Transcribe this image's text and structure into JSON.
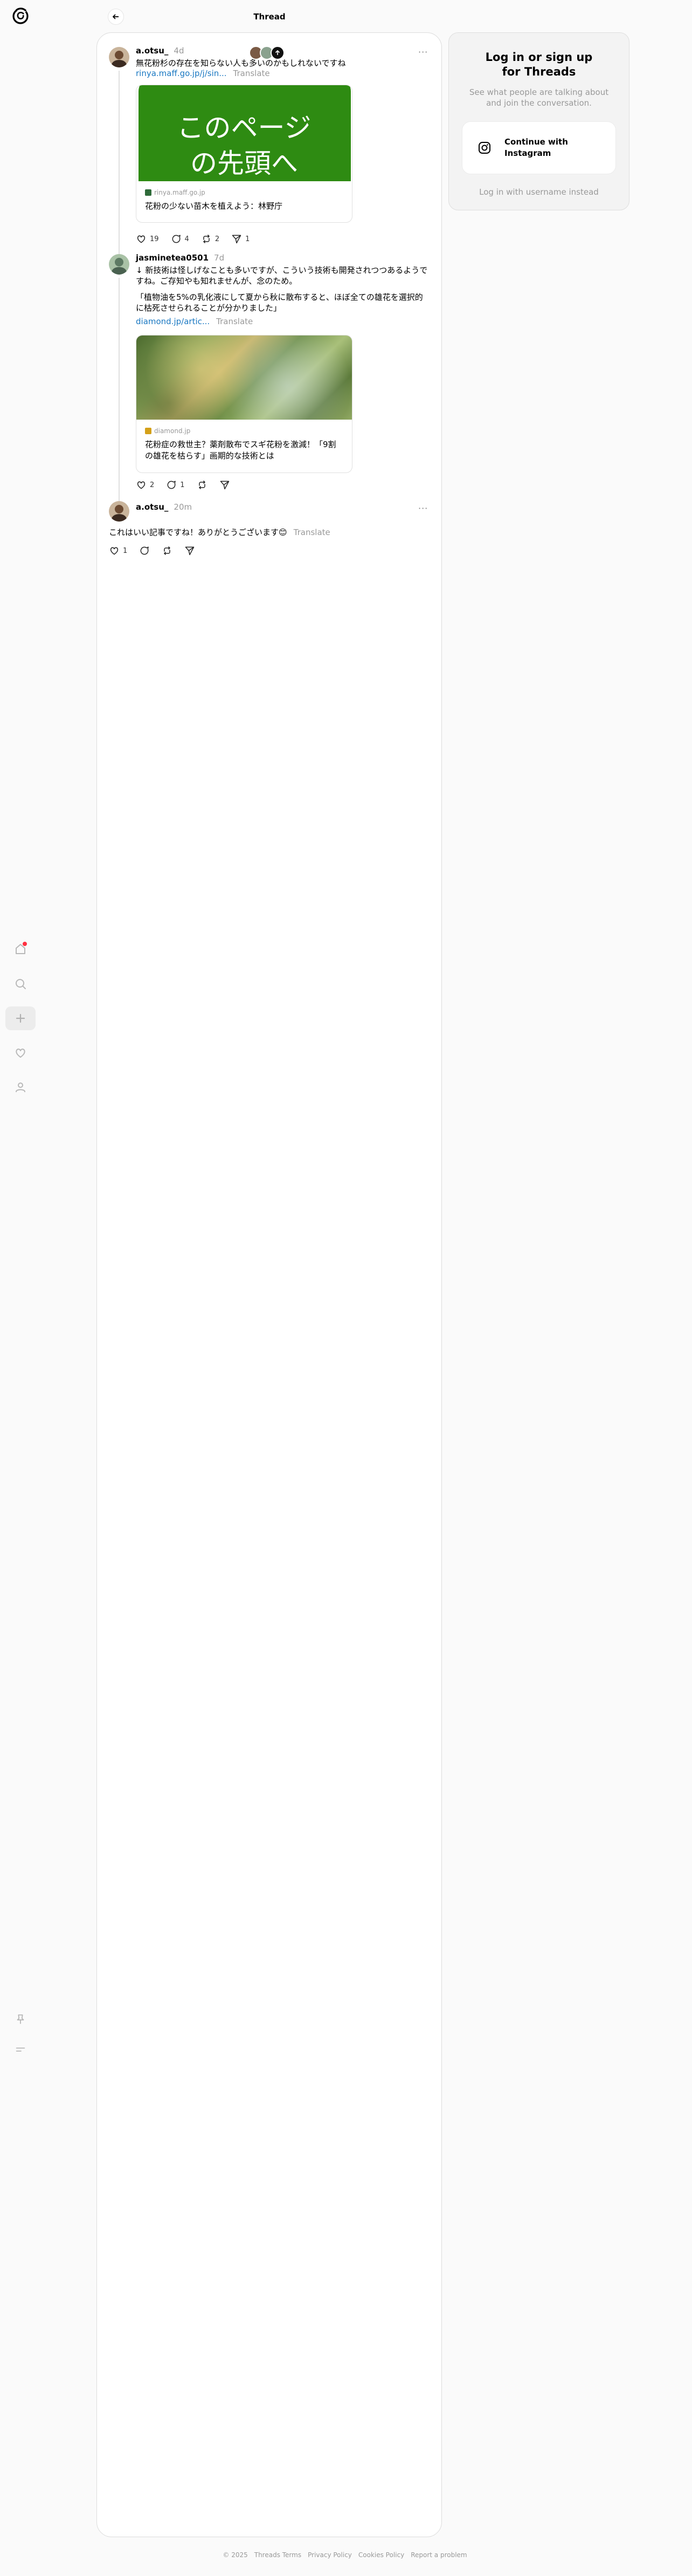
{
  "header": {
    "title": "Thread",
    "back_icon": "back-arrow-icon"
  },
  "nav": {
    "items": [
      "home-icon",
      "search-icon",
      "create-icon",
      "activity-icon",
      "profile-icon"
    ],
    "bottom": [
      "pin-icon",
      "menu-icon"
    ]
  },
  "thread": {
    "posts": [
      {
        "username": "a.otsu_",
        "time": "4d",
        "text": "無花粉杉の存在を知らない人も多いのかもしれないですね",
        "link_text": "rinya.maff.go.jp/j/sin...",
        "translate": "Translate",
        "card": {
          "image_text_line1": "このページ",
          "image_text_line2": "の先頭へ",
          "image_color": "#2e8b12",
          "domain": "rinya.maff.go.jp",
          "title": "花粉の少ない苗木を植えよう：林野庁"
        },
        "likes": "19",
        "replies": "4",
        "reposts": "2",
        "shares": "1"
      },
      {
        "username": "jasminetea0501",
        "time": "7d",
        "text1": "↓ 新技術は怪しげなことも多いですが、こういう技術も開発されつつあるようですね。ご存知やも知れませんが、念のため。",
        "text2": "「植物油を5%の乳化液にして夏から秋に散布すると、ほぼ全ての雄花を選択的に枯死させられることが分かりました」",
        "link_text": "diamond.jp/artic...",
        "translate": "Translate",
        "card": {
          "domain": "diamond.jp",
          "title": "花粉症の救世主？薬剤散布でスギ花粉を激減！「9割の雄花を枯らす」画期的な技術とは"
        },
        "likes": "2",
        "replies": "1"
      },
      {
        "username": "a.otsu_",
        "time": "20m",
        "text": "これはいい記事ですね！ありがとうございます😊",
        "translate": "Translate",
        "likes": "1"
      }
    ]
  },
  "login": {
    "title": "Log in or sign up for Threads",
    "subtitle": "See what people are talking about and join the conversation.",
    "instagram_button": "Continue with Instagram",
    "alt_login": "Log in with username instead"
  },
  "footer": {
    "copyright": "© 2025",
    "links": [
      "Threads Terms",
      "Privacy Policy",
      "Cookies Policy",
      "Report a problem"
    ]
  }
}
